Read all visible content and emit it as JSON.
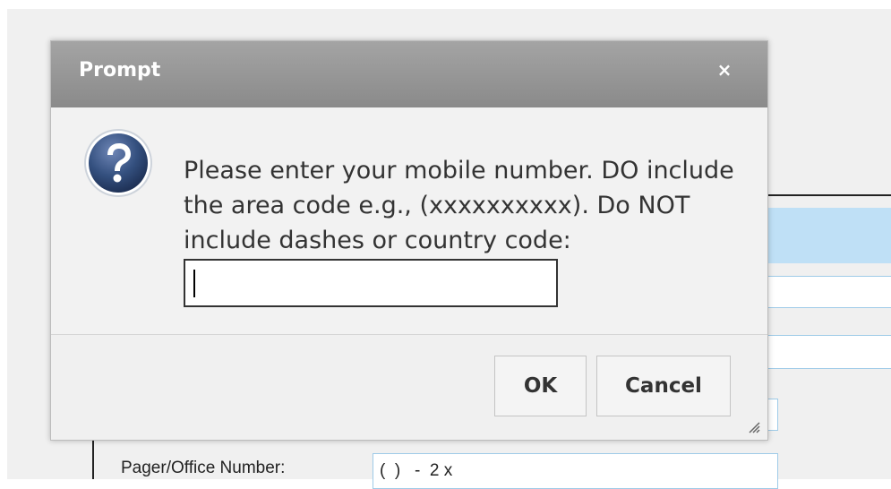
{
  "dialog": {
    "title": "Prompt",
    "close_icon": "×",
    "message": "Please enter your mobile number. DO include the area code e.g., (xxxxxxxxxx). Do NOT include dashes or country code:",
    "input_value": "",
    "ok_label": "OK",
    "cancel_label": "Cancel"
  },
  "background": {
    "pager_label": "Pager/Office Number:",
    "pager_value": "(  )   -  2 x"
  },
  "icons": {
    "question": "question-mark-icon",
    "close": "close-icon",
    "resize": "resize-grip-icon"
  },
  "colors": {
    "titlebar": "#999999",
    "highlight": "#bfe0f6",
    "field_border": "#9fcbe8"
  }
}
